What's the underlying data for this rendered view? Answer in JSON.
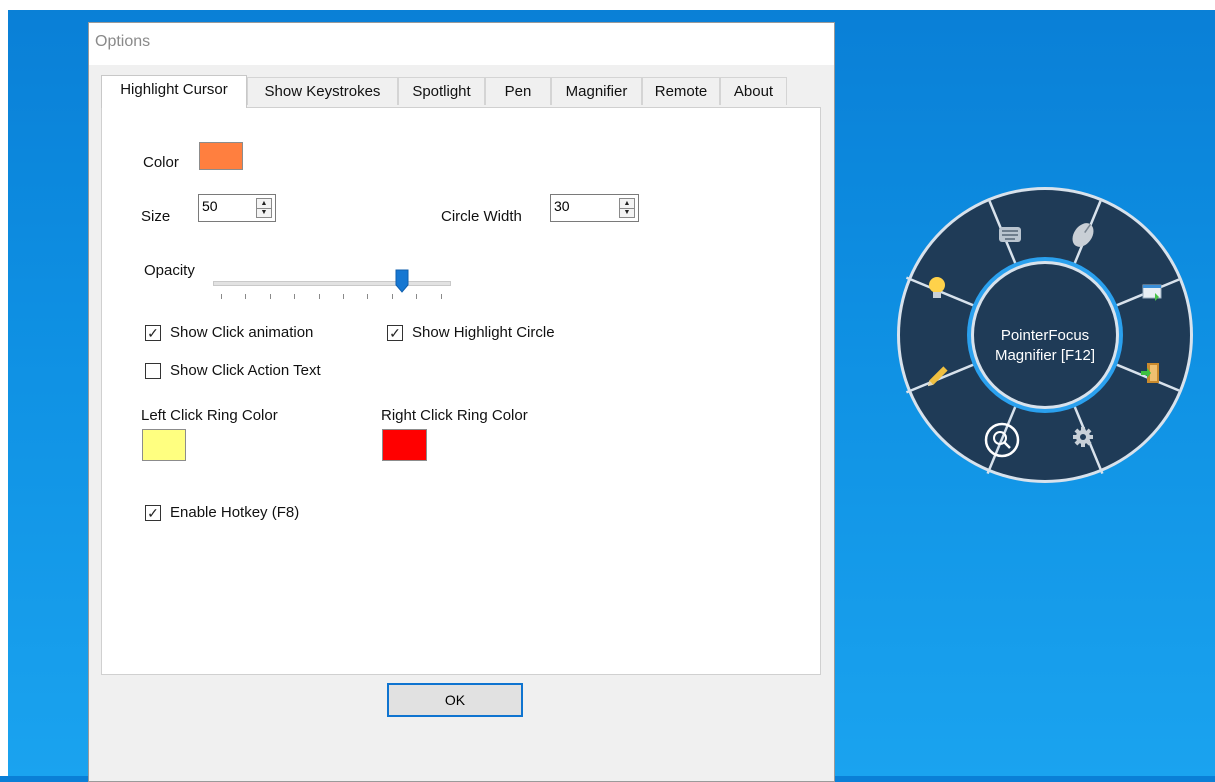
{
  "window": {
    "title": "Options"
  },
  "tabs": [
    {
      "label": "Highlight Cursor",
      "active": true
    },
    {
      "label": "Show Keystrokes"
    },
    {
      "label": "Spotlight"
    },
    {
      "label": "Pen"
    },
    {
      "label": "Magnifier"
    },
    {
      "label": "Remote"
    },
    {
      "label": "About"
    }
  ],
  "highlight": {
    "color_label": "Color",
    "color_value": "#ff7f3f",
    "size_label": "Size",
    "size_value": "50",
    "circle_width_label": "Circle Width",
    "circle_width_value": "30",
    "opacity_label": "Opacity",
    "opacity_fraction": 0.8,
    "show_click_animation": {
      "label": "Show Click animation",
      "checked": true
    },
    "show_highlight_circle": {
      "label": "Show Highlight Circle",
      "checked": true
    },
    "show_click_action_text": {
      "label": "Show Click Action Text",
      "checked": false
    },
    "left_ring_label": "Left Click Ring Color",
    "left_ring_color": "#ffff80",
    "right_ring_label": "Right Click Ring Color",
    "right_ring_color": "#ff0000",
    "enable_hotkey": {
      "label": "Enable Hotkey (F8)",
      "checked": true
    }
  },
  "buttons": {
    "ok": "OK"
  },
  "radial_menu": {
    "line1": "PointerFocus",
    "line2": "Magnifier [F12]",
    "items": [
      "keyboard-icon",
      "mouse-icon",
      "window-icon",
      "exit-door-icon",
      "gear-icon",
      "magnifier-icon",
      "pen-icon",
      "lightbulb-icon"
    ],
    "colors": {
      "ring": "#1f3b57",
      "border": "#d8e2ec",
      "accent": "#2aa0ee"
    }
  }
}
